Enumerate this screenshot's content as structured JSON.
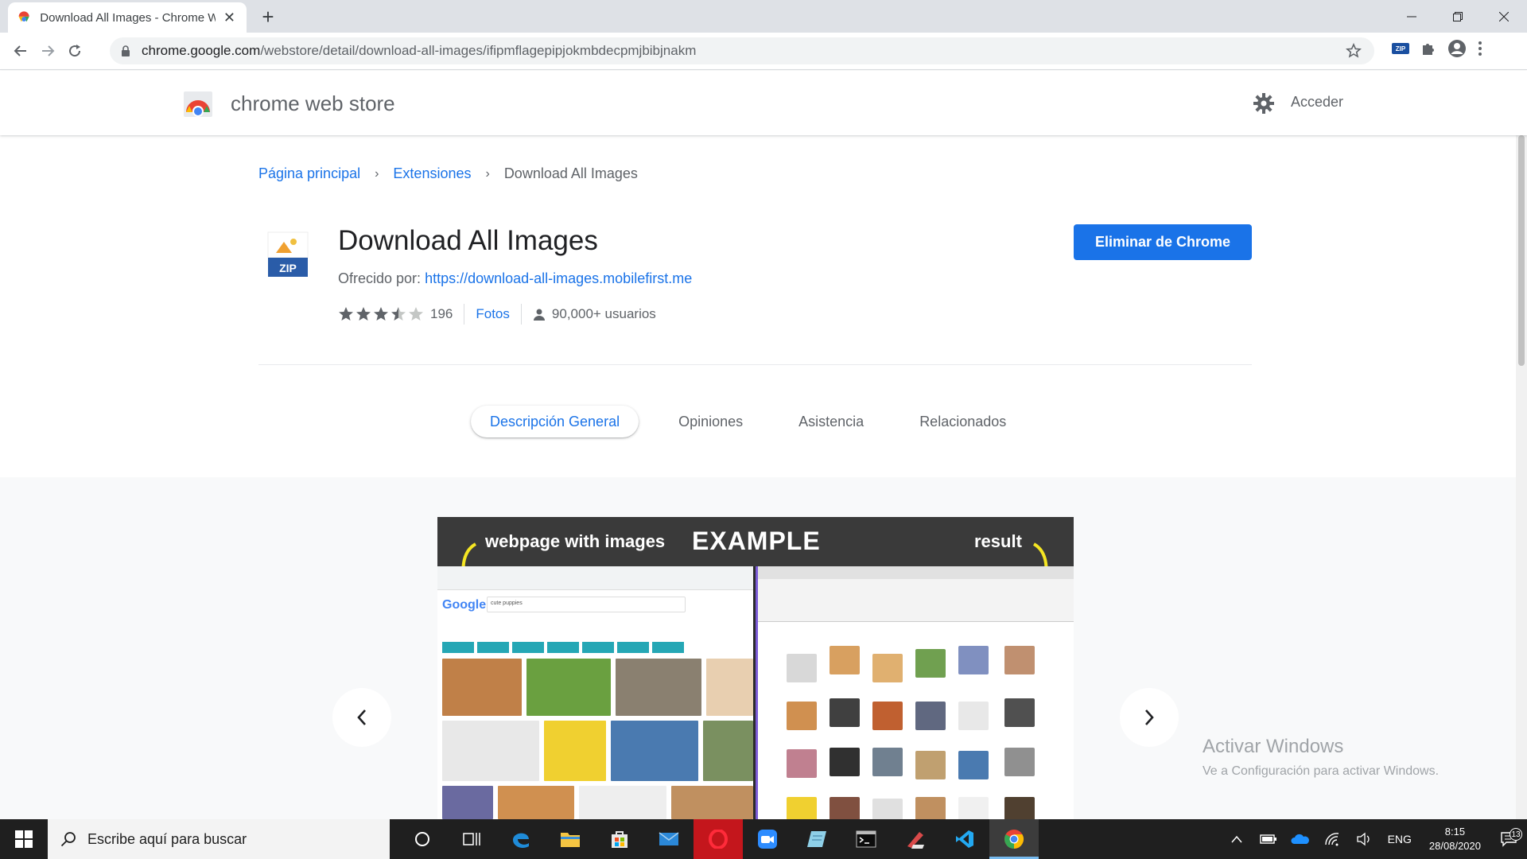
{
  "browser": {
    "tab_title": "Download All Images - Chrome W",
    "url_host": "chrome.google.com",
    "url_path": "/webstore/detail/download-all-images/ifipmflagepipjokmbdecpmjbibjnakm",
    "ext_badge": "ZIP"
  },
  "store": {
    "name": "chrome web store",
    "signin_label": "Acceder"
  },
  "breadcrumb": {
    "home": "Página principal",
    "category": "Extensiones",
    "current": "Download All Images"
  },
  "extension": {
    "icon_label": "ZIP",
    "title": "Download All Images",
    "offered_label": "Ofrecido por:",
    "offered_url": "https://download-all-images.mobilefirst.me",
    "rating": 3.5,
    "rating_max": 5,
    "rating_count": "196",
    "category_link": "Fotos",
    "users": "90,000+ usuarios",
    "action_button": "Eliminar de Chrome"
  },
  "tabs": [
    {
      "label": "Descripción General",
      "active": true
    },
    {
      "label": "Opiniones",
      "active": false
    },
    {
      "label": "Asistencia",
      "active": false
    },
    {
      "label": "Relacionados",
      "active": false
    }
  ],
  "screenshot": {
    "left_caption": "webpage with images",
    "center_caption": "EXAMPLE",
    "right_caption": "result",
    "google_logo": "Google",
    "search_query": "cute puppies"
  },
  "watermark": {
    "title": "Activar Windows",
    "subtitle": "Ve a Configuración para activar Windows."
  },
  "taskbar": {
    "search_placeholder": "Escribe aquí para buscar",
    "language": "ENG",
    "time": "8:15",
    "date": "28/08/2020",
    "notification_count": "13"
  },
  "colors": {
    "accent": "#1a73e8",
    "tabstrip": "#dee1e6",
    "taskbar": "#1f1f1f"
  }
}
